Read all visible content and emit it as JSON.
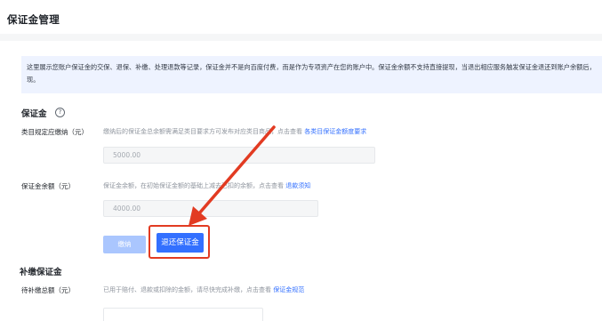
{
  "page": {
    "title": "保证金管理"
  },
  "notice": {
    "text": "这里展示您账户保证金的交保、退保、补缴、处理退款等记录，保证金并不是向百度付费，而是作为专项资产在您的账户中。保证金余额不支持直接提现，当退出相应服务触发保证金退还到账户余额后，现。"
  },
  "deposit_section": {
    "title": "保证金",
    "help_glyph": "?",
    "required_row": {
      "label": "类目规定应缴纳（元）",
      "desc": "缴纳后的保证金总余额需满足类目要求方可发布对应类目商品，点击查看",
      "link": "各类目保证金额度要求",
      "value": "5000.00"
    },
    "balance_row": {
      "label": "保证金余额（元）",
      "desc": "保证金余额，在初始保证金额的基础上减去已扣的余额，点击查看",
      "link": "退款须知",
      "value": "4000.00"
    },
    "buttons": {
      "pay_label": "缴纳",
      "refund_label": "退还保证金"
    }
  },
  "supplement_section": {
    "title": "补缴保证金",
    "row": {
      "label": "待补缴总额（元）",
      "desc": "已用于赔付、退款或扣除的金额，请尽快完成补缴，点击查看",
      "link": "保证金规范"
    }
  },
  "annotation": {
    "color": "#e23b22"
  }
}
